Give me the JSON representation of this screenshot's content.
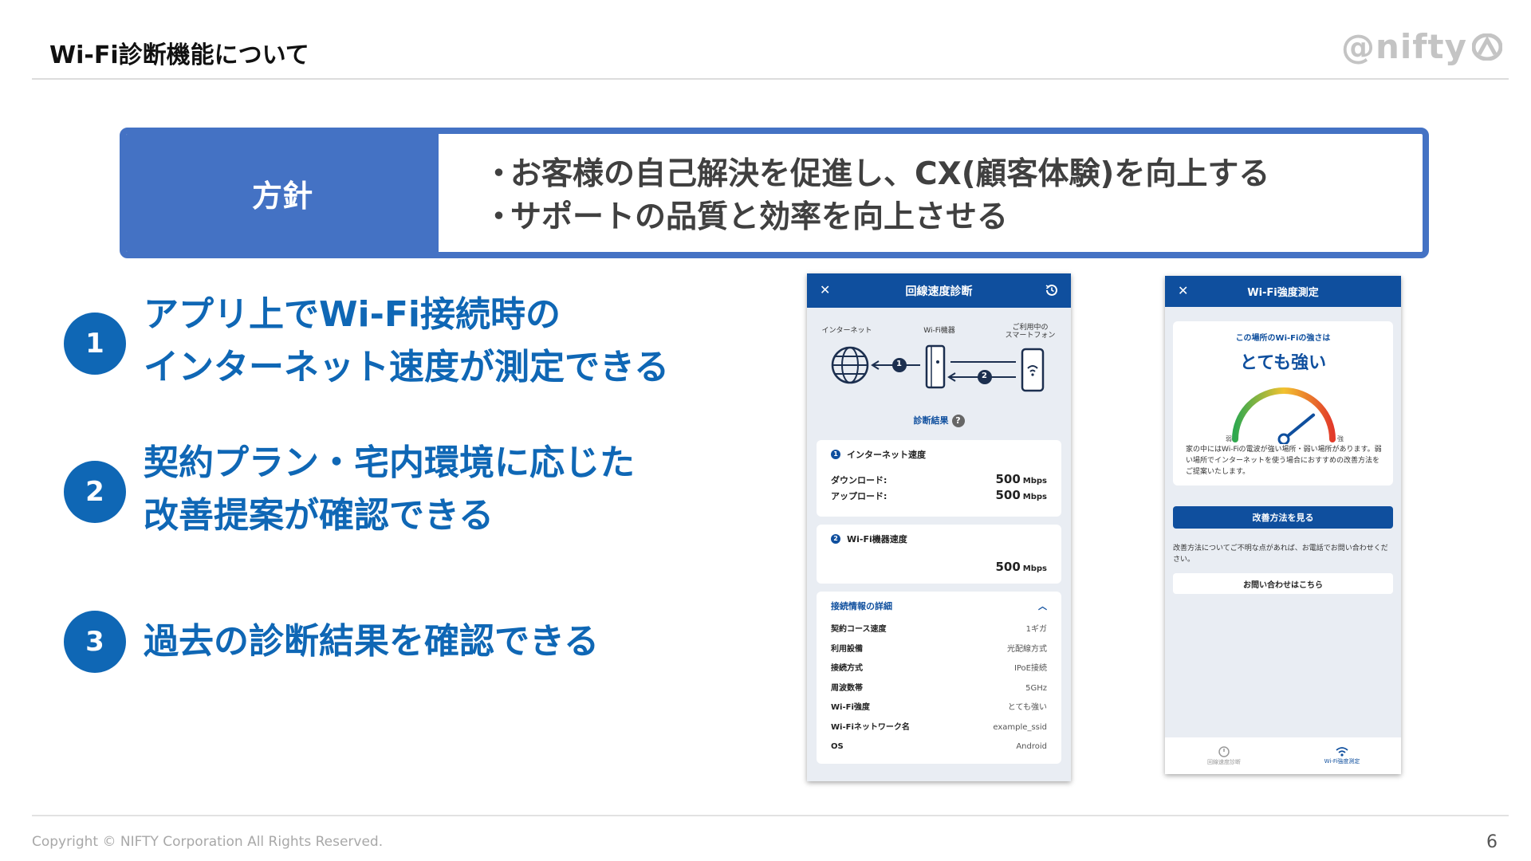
{
  "header": {
    "title": "Wi-Fi診断機能について",
    "logo": "@nifty"
  },
  "policy": {
    "label": "方針",
    "items": [
      "お客様の自己解決を促進し、CX(顧客体験)を向上する",
      "サポートの品質と効率を向上させる"
    ]
  },
  "features": [
    {
      "num": "1",
      "line1": "アプリ上でWi-Fi接続時の",
      "line2": "インターネット速度が測定できる"
    },
    {
      "num": "2",
      "line1": "契約プラン・宅内環境に応じた",
      "line2": "改善提案が確認できる"
    },
    {
      "num": "3",
      "line1": "過去の診断結果を確認できる"
    }
  ],
  "speed_screen": {
    "title": "回線速度診断",
    "close": "✕",
    "diagram": {
      "internet": "インターネット",
      "router": "Wi-Fi機器",
      "phone_line1": "ご利用中の",
      "phone_line2": "スマートフォン",
      "step1": "1",
      "step2": "2"
    },
    "results_heading": "診断結果",
    "help_mark": "?",
    "internet_card": {
      "badge": "1",
      "title": "インターネット速度",
      "download_label": "ダウンロード:",
      "download_value": "500",
      "upload_label": "アップロード:",
      "upload_value": "500",
      "unit": "Mbps"
    },
    "wifi_card": {
      "badge": "2",
      "title": "Wi-Fi機器速度",
      "value": "500",
      "unit": "Mbps"
    },
    "details": {
      "title": "接続情報の詳細",
      "chevron": "︿",
      "rows": [
        {
          "k": "契約コース速度",
          "v": "1ギガ"
        },
        {
          "k": "利用設備",
          "v": "光配線方式"
        },
        {
          "k": "接続方式",
          "v": "IPoE接続"
        },
        {
          "k": "周波数帯",
          "v": "5GHz"
        },
        {
          "k": "Wi-Fi強度",
          "v": "とても強い"
        },
        {
          "k": "Wi-Fiネットワーク名",
          "v": "example_ssid"
        },
        {
          "k": "OS",
          "v": "Android"
        }
      ]
    }
  },
  "strength_screen": {
    "title": "Wi-Fi強度測定",
    "close": "✕",
    "caption": "この場所のWi-Fiの強さは",
    "result": "とても強い",
    "gauge_low": "弱",
    "gauge_high": "強",
    "gauge_level": 0.9,
    "description": "家の中にはWi-Fiの電波が強い場所・弱い場所があります。弱い場所でインターネットを使う場合におすすめの改善方法をご提案いたします。",
    "primary_button": "改善方法を見る",
    "help_text": "改善方法についてご不明な点があれば、お電話でお問い合わせください。",
    "secondary_button": "お問い合わせはこちら",
    "nav": [
      {
        "label": "回線速度診断"
      },
      {
        "label": "Wi-Fi強度測定"
      }
    ]
  },
  "colors": {
    "policy_blue": "#4472c4",
    "feature_blue": "#0f67b5",
    "app_navy": "#0f4f9e"
  },
  "footer": {
    "copyright": "Copyright © NIFTY Corporation All Rights Reserved.",
    "page": "6"
  }
}
